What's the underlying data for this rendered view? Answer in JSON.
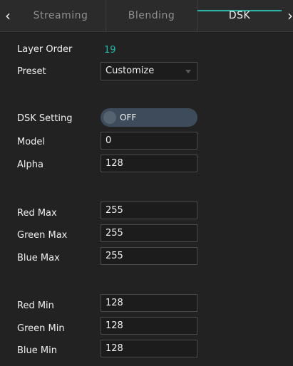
{
  "tabs": {
    "prev_icon": "chevron-left-icon",
    "next_icon": "chevron-right-icon",
    "items": [
      {
        "label": "Streaming"
      },
      {
        "label": "Blending"
      },
      {
        "label": "DSK"
      }
    ],
    "active_index": 2
  },
  "layer_order": {
    "label": "Layer Order",
    "value": "19"
  },
  "preset": {
    "label": "Preset",
    "value": "Customize"
  },
  "dsk_setting": {
    "label": "DSK Setting",
    "state": "OFF"
  },
  "model": {
    "label": "Model",
    "value": "0"
  },
  "alpha": {
    "label": "Alpha",
    "value": "128"
  },
  "red_max": {
    "label": "Red Max",
    "value": "255"
  },
  "green_max": {
    "label": "Green Max",
    "value": "255"
  },
  "blue_max": {
    "label": "Blue Max",
    "value": "255"
  },
  "red_min": {
    "label": "Red Min",
    "value": "128"
  },
  "green_min": {
    "label": "Green Min",
    "value": "128"
  },
  "blue_min": {
    "label": "Blue Min",
    "value": "128"
  },
  "colors": {
    "background": "#222222",
    "accent": "#1fb8a8",
    "toggle_off": "#3e4b5a"
  }
}
